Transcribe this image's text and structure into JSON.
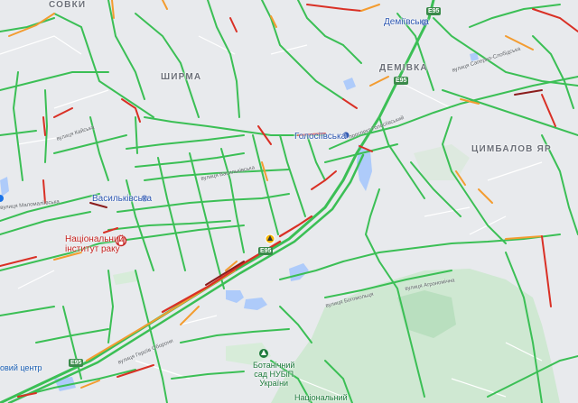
{
  "map": {
    "districts": {
      "sovky": "СОВКИ",
      "shyrma": "ШИРМА",
      "demiivka": "ДЕМІВКА",
      "tsymbalov_yar": "ЦИМБАЛОВ ЯР"
    },
    "metro": {
      "demiivska": "Деміївська",
      "holosiivska": "Голосіївська",
      "vasylkivska": "Васильківська"
    },
    "poi": {
      "cancer_institute": "Національний\nінститут раку",
      "botanical_garden": "Ботанічний\nсад НУБіП\nУкраїни",
      "national_bottom": "Національний",
      "center_left": "овий центр"
    },
    "streets": {
      "kaifska": "вулиця Кайська",
      "vasylkivska": "вулиця Васильківська",
      "holosiivska_prosp": "проспект Голосіївський",
      "saperno_slobidska": "вулиця Саперно-Слобідська",
      "bohomoltsa": "вулиця Богомольця",
      "heroiv_oborony": "вулиця Героїв Оборони",
      "ahroomolohichna": "вулиця Агрономічна",
      "malokytaivska": "вулиця Маломаліївська"
    },
    "road_badges": {
      "e95_top": "E95",
      "e95_mid": "E95",
      "e95_low": "E95",
      "e95_bottom": "E95"
    },
    "colors": {
      "traffic_fast": "#3bbf55",
      "traffic_medium": "#f39c30",
      "traffic_slow": "#d93025",
      "traffic_heavy": "#8b1c1c",
      "water": "#aecbfa",
      "park": "#c8e6c9",
      "background": "#e8eaed"
    }
  }
}
